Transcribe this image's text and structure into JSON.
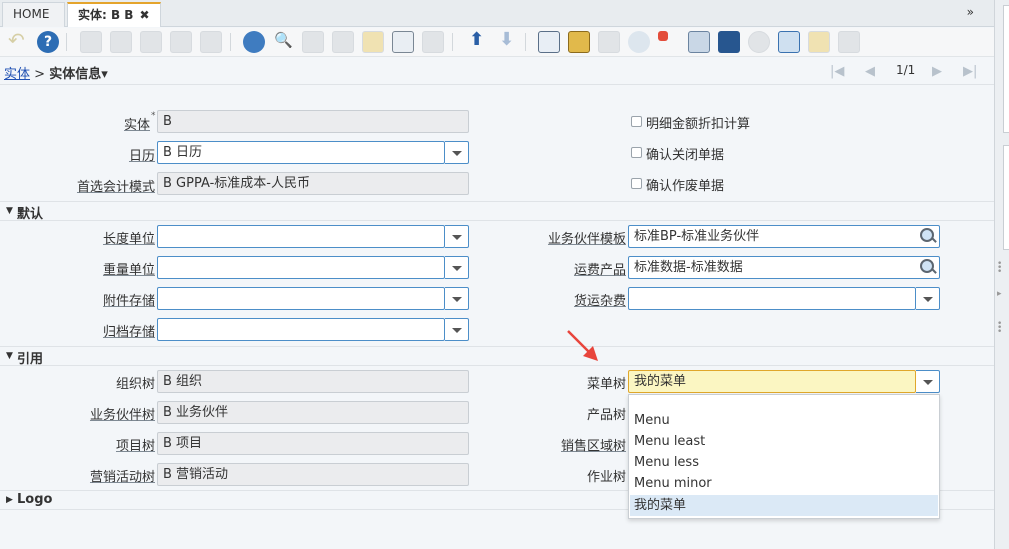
{
  "tabs": {
    "home": "HOME",
    "active": "实体: B B",
    "close": "✖",
    "collapse": "»"
  },
  "breadcrumb": {
    "root": "实体",
    "sep": ">",
    "current": "实体信息▾"
  },
  "nav": {
    "first": "|◀",
    "prev": "◀",
    "counter": "1/1",
    "next": "▶",
    "last": "▶|"
  },
  "main": {
    "entity": {
      "label": "实体",
      "required": "*",
      "value": "B"
    },
    "calendar": {
      "label": "日历",
      "value": "B 日历"
    },
    "accounting": {
      "label": "首选会计模式",
      "value": "B GPPA-标准成本-人民币"
    },
    "checkboxes": [
      "明细金额折扣计算",
      "确认关闭单据",
      "确认作废单据"
    ]
  },
  "sections": {
    "default": "默认",
    "reference": "引用",
    "logo": "Logo",
    "expanded_icon": "▼",
    "collapsed_icon": "▶"
  },
  "defaults": {
    "length_uom": {
      "label": "长度单位",
      "value": ""
    },
    "weight_uom": {
      "label": "重量单位",
      "value": ""
    },
    "attachment_store": {
      "label": "附件存储",
      "value": ""
    },
    "archive_store": {
      "label": "归档存储",
      "value": ""
    },
    "bp_template": {
      "label": "业务伙伴模板",
      "value": "标准BP-标准业务伙伴"
    },
    "freight_product": {
      "label": "运费产品",
      "value": "标准数据-标准数据"
    },
    "freight_charge": {
      "label": "货运杂费",
      "value": ""
    }
  },
  "references": {
    "org_tree": {
      "label": "组织树",
      "value": "B 组织"
    },
    "bp_tree": {
      "label": "业务伙伴树",
      "value": "B 业务伙伴"
    },
    "project_tree": {
      "label": "项目树",
      "value": "B 项目"
    },
    "campaign_tree": {
      "label": "营销活动树",
      "value": "B 营销活动"
    },
    "menu_tree": {
      "label": "菜单树",
      "value": "我的菜单"
    },
    "product_tree": {
      "label": "产品树"
    },
    "sales_region_tree": {
      "label": "销售区域树"
    },
    "activity_tree": {
      "label": "作业树"
    }
  },
  "menu_dropdown": {
    "options": [
      "",
      "Menu",
      "Menu least",
      "Menu less",
      "Menu minor",
      "我的菜单"
    ],
    "selected_index": 5
  },
  "colors": {
    "accent": "#e4a42c",
    "link": "#1f50b3",
    "field_border": "#4c8ec8",
    "highlight": "#fbf6c2",
    "arrow": "#e8453c"
  }
}
